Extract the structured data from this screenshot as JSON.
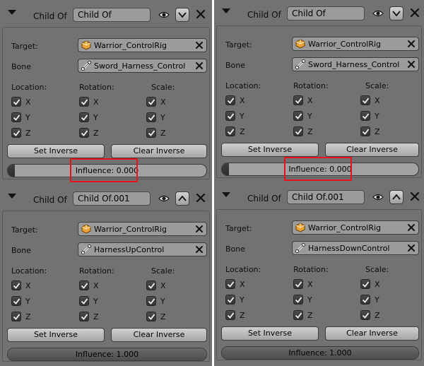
{
  "panels": [
    {
      "id": "left",
      "constraints": [
        {
          "type_label": "Child Of",
          "name": "Child Of",
          "move_direction": "down",
          "target_label": "Target:",
          "target_value": "Warrior_ControlRig",
          "bone_label": "Bone",
          "bone_value": "Sword_Harness_Control",
          "location_label": "Location:",
          "rotation_label": "Rotation:",
          "scale_label": "Scale:",
          "axes": [
            "X",
            "Y",
            "Z"
          ],
          "set_inverse_label": "Set Inverse",
          "clear_inverse_label": "Clear Inverse",
          "influence_text": "Influence: 0.000",
          "influence_value": 0.0,
          "highlighted": true
        },
        {
          "type_label": "Child Of",
          "name": "Child Of.001",
          "move_direction": "up",
          "target_label": "Target:",
          "target_value": "Warrior_ControlRig",
          "bone_label": "Bone",
          "bone_value": "HarnessUpControl",
          "location_label": "Location:",
          "rotation_label": "Rotation:",
          "scale_label": "Scale:",
          "axes": [
            "X",
            "Y",
            "Z"
          ],
          "set_inverse_label": "Set Inverse",
          "clear_inverse_label": "Clear Inverse",
          "influence_text": "Influence: 1.000",
          "influence_value": 1.0,
          "highlighted": false
        }
      ]
    },
    {
      "id": "right",
      "constraints": [
        {
          "type_label": "Child Of",
          "name": "Child Of",
          "move_direction": "down",
          "target_label": "Target:",
          "target_value": "Warrior_ControlRig",
          "bone_label": "Bone",
          "bone_value": "Sword_Harness_Control",
          "location_label": "Location:",
          "rotation_label": "Rotation:",
          "scale_label": "Scale:",
          "axes": [
            "X",
            "Y",
            "Z"
          ],
          "set_inverse_label": "Set Inverse",
          "clear_inverse_label": "Clear Inverse",
          "influence_text": "Influence: 0.000",
          "influence_value": 0.0,
          "highlighted": true
        },
        {
          "type_label": "Child Of",
          "name": "Child Of.001",
          "move_direction": "up",
          "target_label": "Target:",
          "target_value": "Warrior_ControlRig",
          "bone_label": "Bone",
          "bone_value": "HarnessDownControl",
          "location_label": "Location:",
          "rotation_label": "Rotation:",
          "scale_label": "Scale:",
          "axes": [
            "X",
            "Y",
            "Z"
          ],
          "set_inverse_label": "Set Inverse",
          "clear_inverse_label": "Clear Inverse",
          "influence_text": "Influence: 1.000",
          "influence_value": 1.0,
          "highlighted": false
        }
      ]
    }
  ],
  "icons": {
    "expand": "triangle-down-icon",
    "visibility": "eye-icon",
    "move_down": "arrow-down-icon",
    "move_up": "arrow-up-icon",
    "delete": "close-x-icon",
    "target": "armature-object-icon",
    "bone": "bone-icon",
    "clear": "clear-x-icon",
    "checkbox": "checkmark-icon"
  },
  "colors": {
    "panel_bg": "#727272",
    "field_bg": "#9b9b9b",
    "highlight": "#e8121b",
    "object_icon": "#e8a336"
  }
}
